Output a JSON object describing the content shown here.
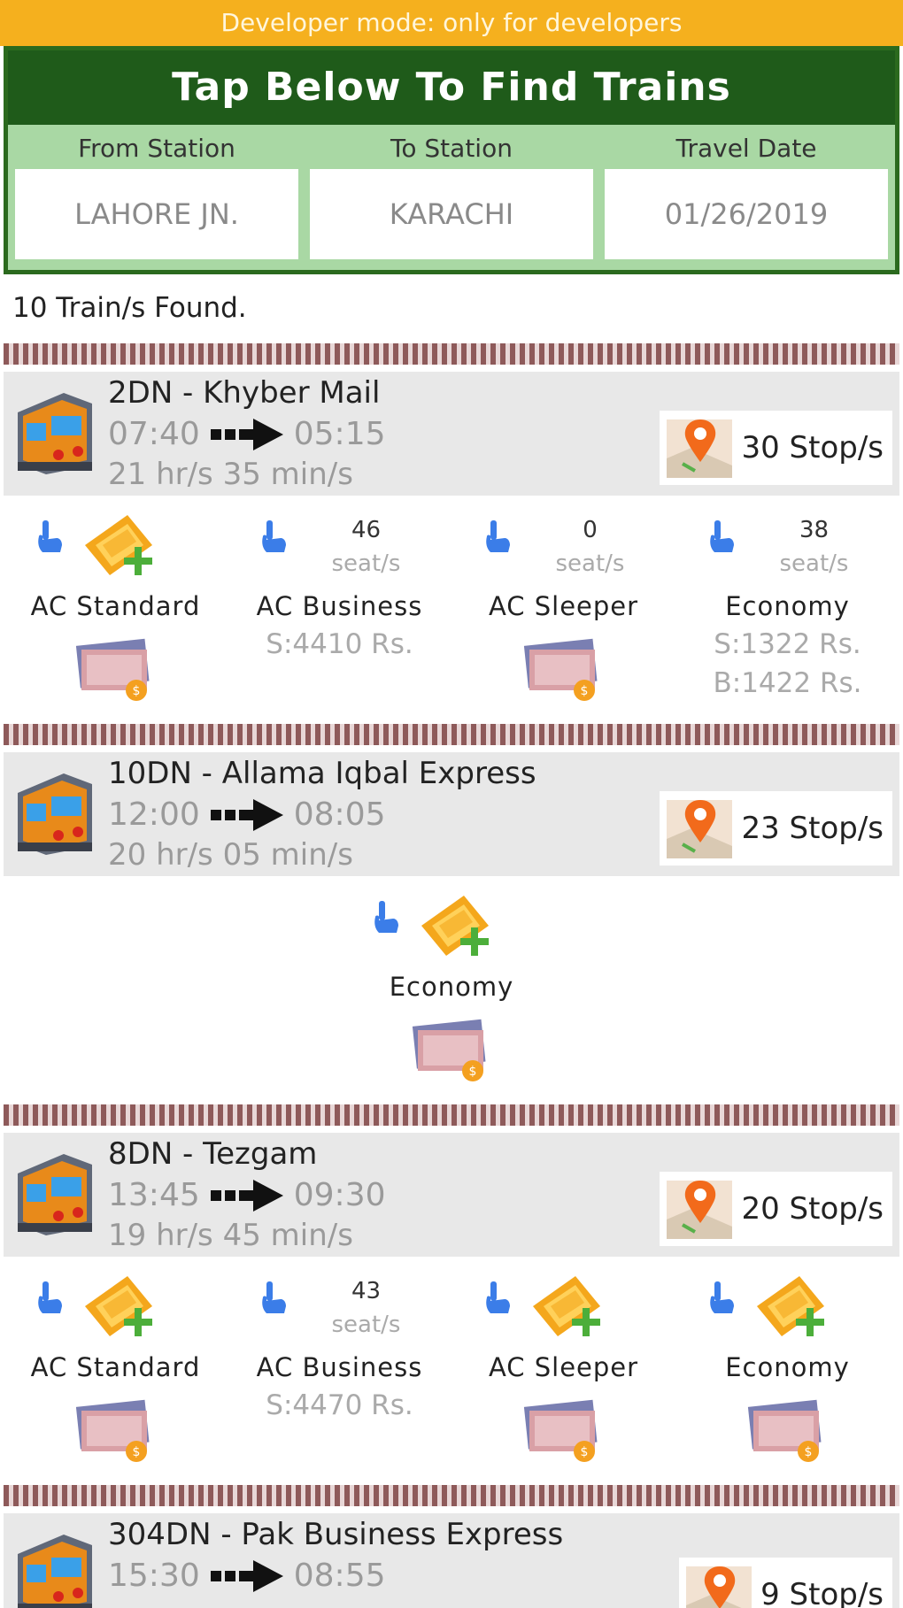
{
  "dev_banner": "Developer mode: only for developers",
  "finder": {
    "title": "Tap Below To Find Trains",
    "from_label": "From Station",
    "to_label": "To Station",
    "date_label": "Travel Date",
    "from_value": "LAHORE JN.",
    "to_value": "KARACHI",
    "date_value": "01/26/2019"
  },
  "results_count": "10 Train/s Found.",
  "colors": {
    "banner": "#f5b01e",
    "header_green": "#1f5b1a",
    "panel_green": "#a9d8a4",
    "rail": "#8e5a5a"
  },
  "icons": {
    "train": "train-front-icon",
    "stops": "map-pin-icon",
    "book": "ticket-add-icon",
    "tap": "pointing-hand-icon",
    "fare": "fare-cash-icon"
  },
  "trains": [
    {
      "name": "2DN - Khyber Mail",
      "depart": "07:40",
      "arrive": "05:15",
      "duration": "21 hr/s 35 min/s",
      "stops": "30 Stop/s",
      "classes": [
        {
          "name": "AC Standard"
        },
        {
          "name": "AC Business",
          "seats": "46",
          "seat_label": "seat/s",
          "price1": "S:4410 Rs."
        },
        {
          "name": "AC Sleeper",
          "seats": "0",
          "seat_label": "seat/s"
        },
        {
          "name": "Economy",
          "seats": "38",
          "seat_label": "seat/s",
          "price1": "S:1322 Rs.",
          "price2": "B:1422 Rs."
        }
      ]
    },
    {
      "name": "10DN - Allama Iqbal Express",
      "depart": "12:00",
      "arrive": "08:05",
      "duration": "20 hr/s 05 min/s",
      "stops": "23 Stop/s",
      "classes": [
        {
          "name": "Economy"
        }
      ]
    },
    {
      "name": "8DN - Tezgam",
      "depart": "13:45",
      "arrive": "09:30",
      "duration": "19 hr/s 45 min/s",
      "stops": "20 Stop/s",
      "classes": [
        {
          "name": "AC Standard"
        },
        {
          "name": "AC Business",
          "seats": "43",
          "seat_label": "seat/s",
          "price1": "S:4470 Rs."
        },
        {
          "name": "AC Sleeper"
        },
        {
          "name": "Economy"
        }
      ]
    },
    {
      "name": "304DN - Pak Business Express",
      "depart": "15:30",
      "arrive": "08:55",
      "stops": "9 Stop/s"
    }
  ]
}
